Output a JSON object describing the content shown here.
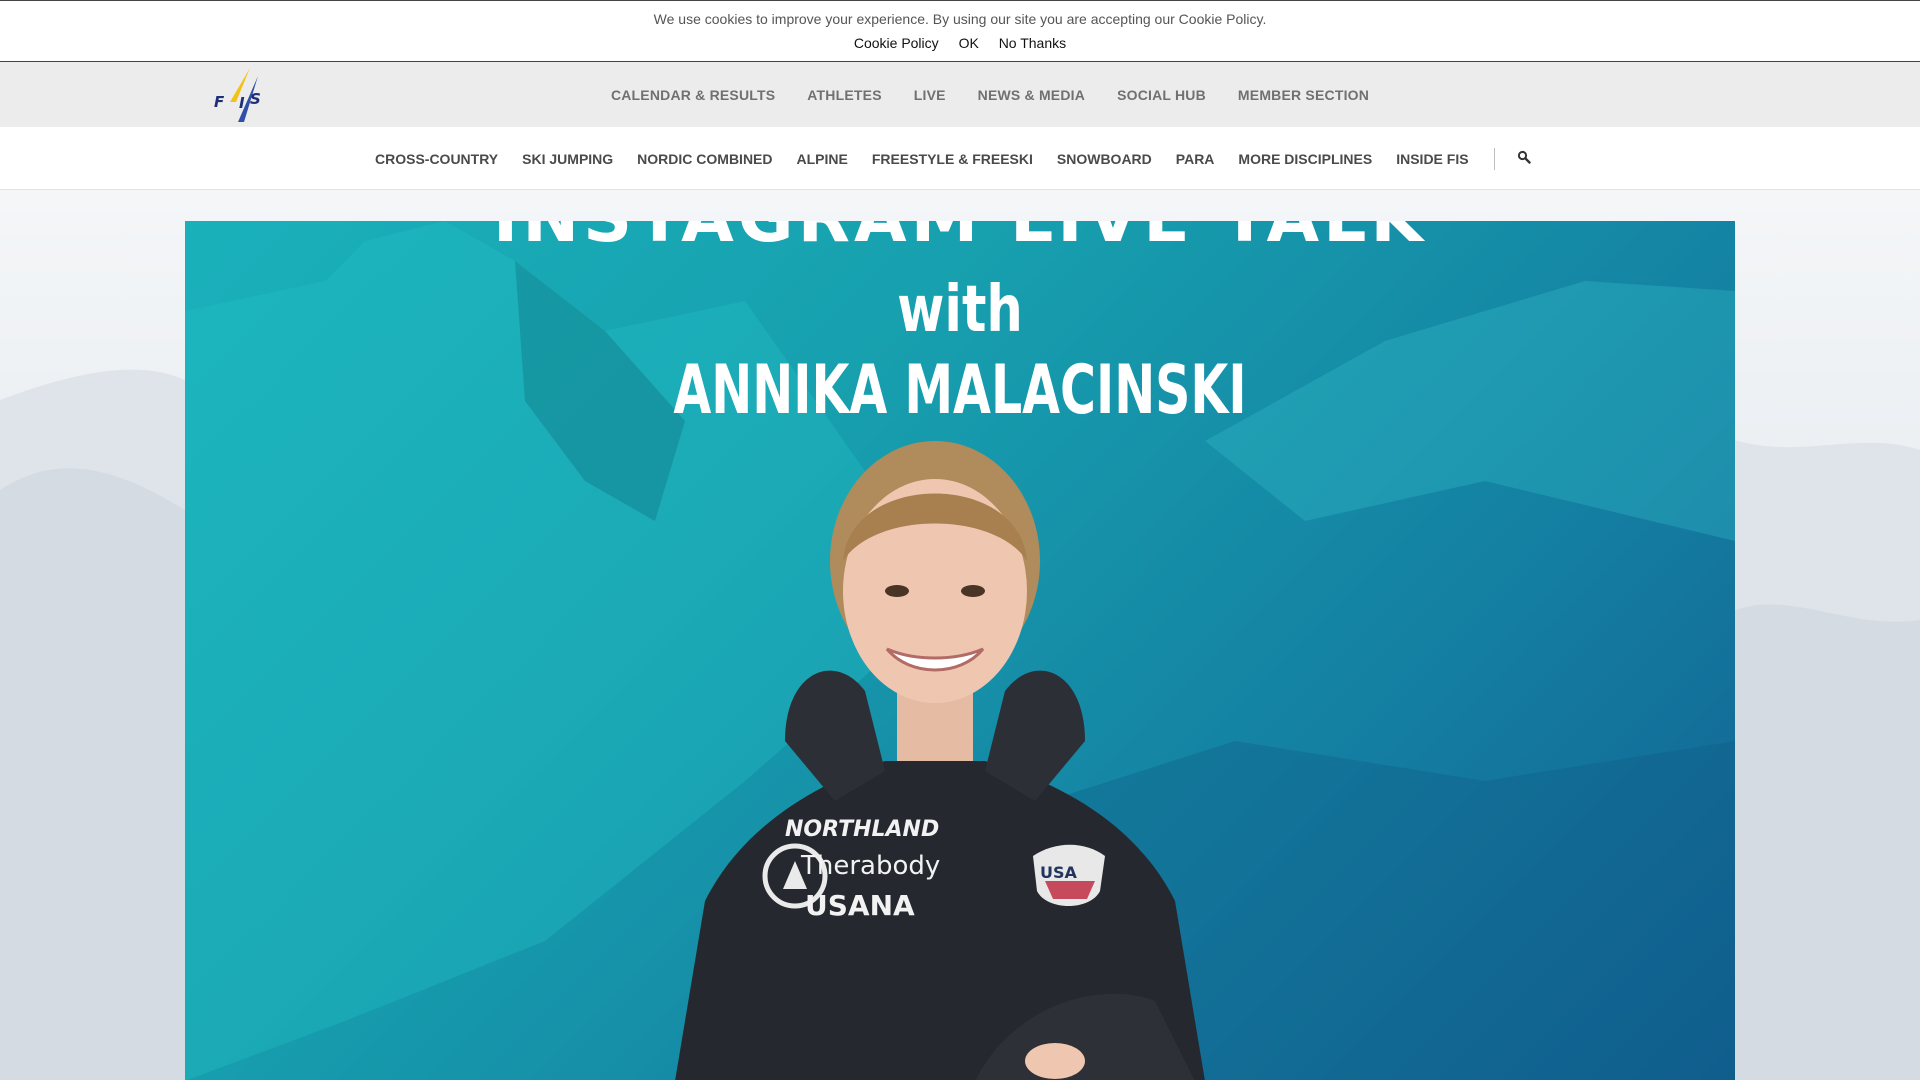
{
  "cookie_bar": {
    "message": "We use cookies to improve your experience. By using our site you are accepting our Cookie Policy.",
    "policy_label": "Cookie Policy",
    "ok_label": "OK",
    "no_thanks_label": "No Thanks"
  },
  "header": {
    "nav": [
      "CALENDAR & RESULTS",
      "ATHLETES",
      "LIVE",
      "NEWS & MEDIA",
      "SOCIAL HUB",
      "MEMBER SECTION"
    ]
  },
  "disciplines": [
    "CROSS-COUNTRY",
    "SKI JUMPING",
    "NORDIC COMBINED",
    "ALPINE",
    "FREESTYLE & FREESKI",
    "SNOWBOARD",
    "PARA",
    "MORE DISCIPLINES",
    "INSIDE FIS"
  ],
  "hero": {
    "title_top": "INSTAGRAM LIVE TALK",
    "with": "with",
    "name": "ANNIKA MALACINSKI",
    "sponsors": {
      "northland": "NORTHLAND",
      "therabody": "Therabody",
      "usana": "USANA",
      "badge": "USA"
    }
  },
  "colors": {
    "hero_start": "#1ab1bb",
    "hero_end": "#125f90",
    "nav_gray": "#707070"
  },
  "icons": {
    "search": "search-icon",
    "logo": "fis-logo"
  }
}
